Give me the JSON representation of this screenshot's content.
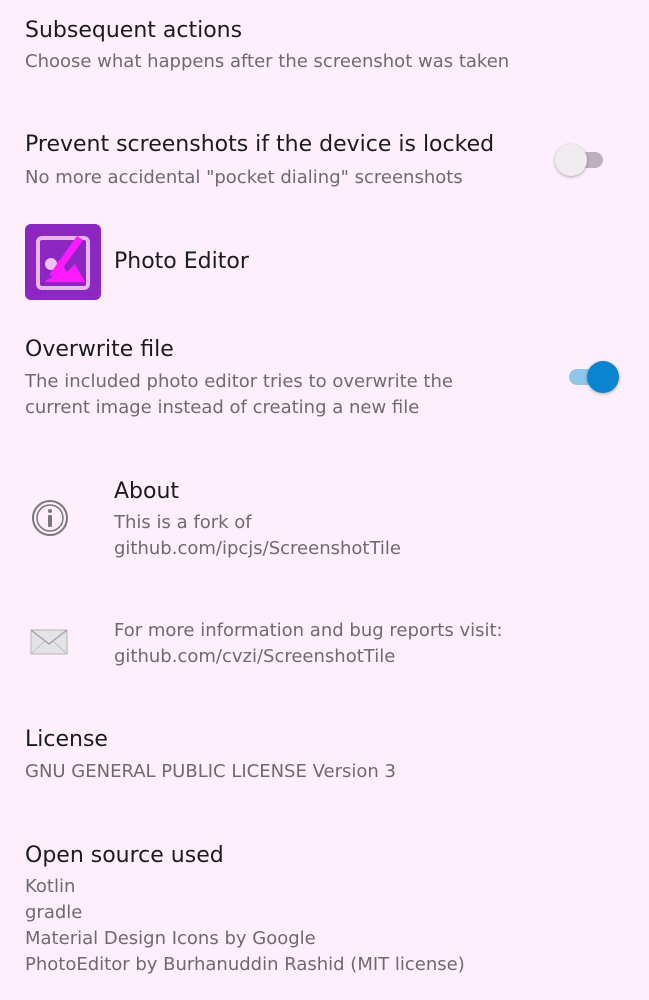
{
  "subsequent_actions": {
    "title": "Subsequent actions",
    "subtitle": "Choose what happens after the screenshot was taken"
  },
  "prevent_screenshots": {
    "title": "Prevent screenshots if the device is locked",
    "subtitle": "No more accidental \"pocket dialing\" screenshots",
    "enabled": false
  },
  "photo_editor": {
    "label": "Photo Editor",
    "icon": "photo-editor-app-icon"
  },
  "overwrite_file": {
    "title": "Overwrite file",
    "subtitle_lines": [
      "The included photo editor tries to overwrite the",
      "current image instead of creating a new file"
    ],
    "enabled": true
  },
  "about": {
    "icon": "info-icon",
    "title": "About",
    "subtitle_lines": [
      "This is a fork of",
      "github.com/ipcjs/ScreenshotTile"
    ]
  },
  "contact": {
    "icon": "mail-icon",
    "subtitle_lines": [
      "For more information and bug reports visit:",
      "github.com/cvzi/ScreenshotTile"
    ]
  },
  "license": {
    "title": "License",
    "subtitle": "GNU GENERAL PUBLIC LICENSE Version 3"
  },
  "open_source": {
    "title": "Open source used",
    "items": [
      "Kotlin",
      "gradle",
      "Material Design Icons by Google",
      "PhotoEditor by Burhanuddin Rashid (MIT license)"
    ]
  },
  "colors": {
    "background": "#fdeffb",
    "accent": "#0a84cf",
    "app_icon": "#8c27c2"
  }
}
